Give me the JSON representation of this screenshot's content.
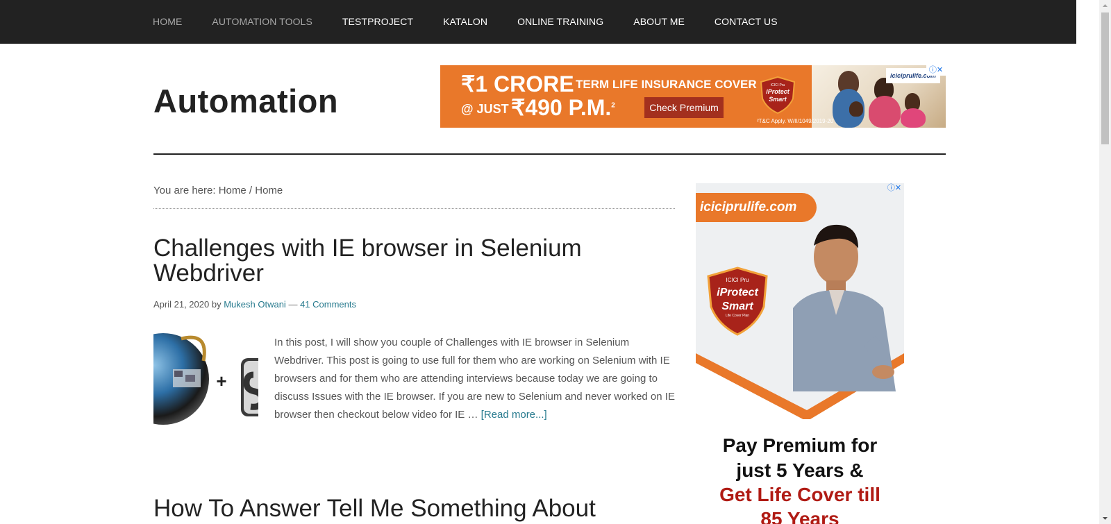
{
  "nav": {
    "items": [
      {
        "label": "HOME"
      },
      {
        "label": "AUTOMATION TOOLS"
      },
      {
        "label": "TESTPROJECT"
      },
      {
        "label": "KATALON"
      },
      {
        "label": "ONLINE TRAINING"
      },
      {
        "label": "ABOUT ME"
      },
      {
        "label": "CONTACT US"
      }
    ]
  },
  "header": {
    "site_title": "Automation"
  },
  "ad_banner": {
    "crore": "₹1 CRORE",
    "term": "TERM LIFE INSURANCE COVER",
    "at_just": "@ JUST",
    "price": "₹490 P.M.",
    "price_sup": "2",
    "cta": "Check Premium",
    "tc": "²T&C Apply. W/II/1049/2019-20",
    "brand": "iciciprulife.com",
    "shield_top": "ICICI Pru",
    "shield_line1": "iProtect",
    "shield_line2": "Smart",
    "info_icon": "info-icon",
    "close_icon": "close-icon"
  },
  "breadcrumb": {
    "prefix": "You are here:",
    "home": "Home",
    "sep": "/",
    "current": "Home"
  },
  "post1": {
    "title": "Challenges with IE browser in Selenium Webdriver",
    "date": "April 21, 2020",
    "by": "by",
    "author": "Mukesh Otwani",
    "dash": "—",
    "comments": "41 Comments",
    "excerpt": "In this post, I will show you couple of Challenges with IE browser in Selenium Webdriver. This post is going to use full for them who are working on Selenium with IE browsers and for them who are attending interviews because today we are going to discuss Issues with the IE browser. If you are new to Selenium and never worked on IE browser then checkout below video for IE …",
    "read_more": "[Read more...]",
    "thumb_plus": "+"
  },
  "post2": {
    "title": "How To Answer Tell Me Something About"
  },
  "ad_side": {
    "brand": "iciciprulife.com",
    "shield_top": "ICICI Pru",
    "shield_line1": "iProtect",
    "shield_line2": "Smart",
    "shield_sub": "Life Cover Plan",
    "line1": "Pay Premium for",
    "line2": "just 5 Years &",
    "line3": "Get Life Cover till",
    "line4": "85 Years",
    "info_icon": "info-icon",
    "close_icon": "close-icon"
  },
  "colors": {
    "nav_bg": "#222222",
    "ad_orange": "#e9782a",
    "link": "#277a8e",
    "ad_red": "#b01b14"
  }
}
